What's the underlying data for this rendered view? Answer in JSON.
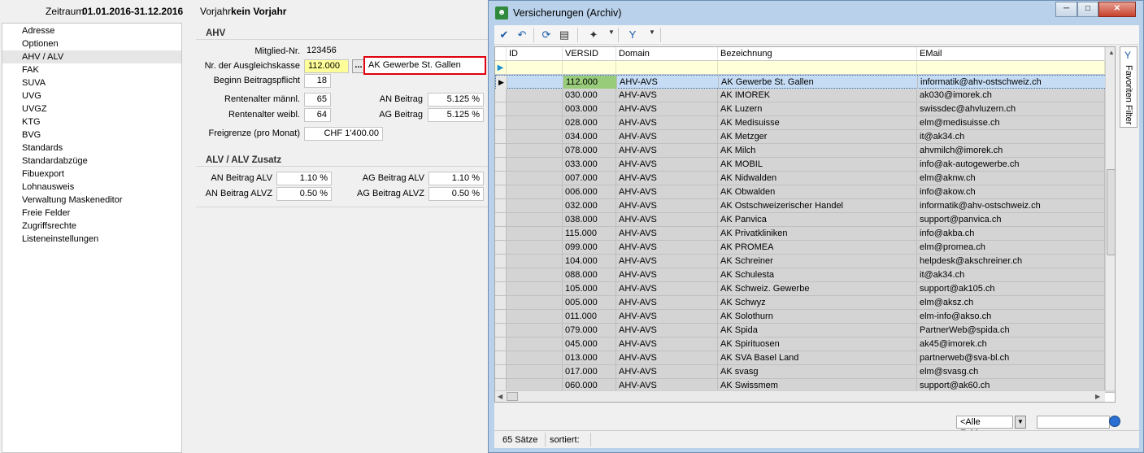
{
  "header": {
    "zeitraum_label": "Zeitraum",
    "zeitraum_value": "01.01.2016-31.12.2016",
    "vorjahr_label": "Vorjahr",
    "vorjahr_value": "kein Vorjahr"
  },
  "sidebar": {
    "items": [
      {
        "label": "Adresse"
      },
      {
        "label": "Optionen"
      },
      {
        "label": "AHV / ALV",
        "selected": true
      },
      {
        "label": "FAK"
      },
      {
        "label": "SUVA"
      },
      {
        "label": "UVG"
      },
      {
        "label": "UVGZ"
      },
      {
        "label": "KTG"
      },
      {
        "label": "BVG"
      },
      {
        "label": "Standards"
      },
      {
        "label": "Standardabzüge"
      },
      {
        "label": "Fibuexport"
      },
      {
        "label": "Lohnausweis"
      },
      {
        "label": "Verwaltung Maskeneditor"
      },
      {
        "label": "Freie Felder"
      },
      {
        "label": "Zugriffsrechte"
      },
      {
        "label": "Listeneinstellungen"
      }
    ]
  },
  "ahv": {
    "title": "AHV",
    "mitglied_label": "Mitglied-Nr.",
    "mitglied_value": "123456",
    "ausgleichskasse_label": "Nr. der Ausgleichskasse",
    "ausgleichskasse_value": "112.000",
    "ausgleichskasse_btn": "...",
    "ausgleichskasse_name": "AK Gewerbe St. Gallen",
    "beginn_label": "Beginn Beitragspflicht",
    "beginn_value": "18",
    "rente_m_label": "Rentenalter männl.",
    "rente_m_value": "65",
    "rente_w_label": "Rentenalter weibl.",
    "rente_w_value": "64",
    "an_label": "AN Beitrag",
    "an_value": "5.125 %",
    "ag_label": "AG Beitrag",
    "ag_value": "5.125 %",
    "freigrenze_label": "Freigrenze (pro Monat)",
    "freigrenze_value": "CHF 1'400.00"
  },
  "alv": {
    "title": "ALV / ALV Zusatz",
    "an_alv_label": "AN Beitrag ALV",
    "an_alv_value": "1.10 %",
    "ag_alv_label": "AG Beitrag ALV",
    "ag_alv_value": "1.10 %",
    "an_alvz_label": "AN Beitrag ALVZ",
    "an_alvz_value": "0.50 %",
    "ag_alvz_label": "AG Beitrag ALVZ",
    "ag_alvz_value": "0.50 %"
  },
  "dialog": {
    "title": "Versicherungen (Archiv)",
    "columns": [
      "ID",
      "VERSID",
      "Domain",
      "Bezeichnung",
      "EMail"
    ],
    "rows": [
      {
        "versid": "112.000",
        "domain": "AHV-AVS",
        "bez": "AK Gewerbe St. Gallen",
        "email": "informatik@ahv-ostschweiz.ch",
        "selected": true
      },
      {
        "versid": "030.000",
        "domain": "AHV-AVS",
        "bez": "AK IMOREK",
        "email": "ak030@imorek.ch"
      },
      {
        "versid": "003.000",
        "domain": "AHV-AVS",
        "bez": "AK Luzern",
        "email": "swissdec@ahvluzern.ch"
      },
      {
        "versid": "028.000",
        "domain": "AHV-AVS",
        "bez": "AK Medisuisse",
        "email": "elm@medisuisse.ch"
      },
      {
        "versid": "034.000",
        "domain": "AHV-AVS",
        "bez": "AK Metzger",
        "email": "it@ak34.ch"
      },
      {
        "versid": "078.000",
        "domain": "AHV-AVS",
        "bez": "AK Milch",
        "email": "ahvmilch@imorek.ch"
      },
      {
        "versid": "033.000",
        "domain": "AHV-AVS",
        "bez": "AK MOBIL",
        "email": "info@ak-autogewerbe.ch"
      },
      {
        "versid": "007.000",
        "domain": "AHV-AVS",
        "bez": "AK Nidwalden",
        "email": "elm@aknw.ch"
      },
      {
        "versid": "006.000",
        "domain": "AHV-AVS",
        "bez": "AK Obwalden",
        "email": "info@akow.ch"
      },
      {
        "versid": "032.000",
        "domain": "AHV-AVS",
        "bez": "AK Ostschweizerischer Handel",
        "email": "informatik@ahv-ostschweiz.ch"
      },
      {
        "versid": "038.000",
        "domain": "AHV-AVS",
        "bez": "AK Panvica",
        "email": "support@panvica.ch"
      },
      {
        "versid": "115.000",
        "domain": "AHV-AVS",
        "bez": "AK Privatkliniken",
        "email": "info@akba.ch"
      },
      {
        "versid": "099.000",
        "domain": "AHV-AVS",
        "bez": "AK PROMEA",
        "email": "elm@promea.ch"
      },
      {
        "versid": "104.000",
        "domain": "AHV-AVS",
        "bez": "AK Schreiner",
        "email": "helpdesk@akschreiner.ch"
      },
      {
        "versid": "088.000",
        "domain": "AHV-AVS",
        "bez": "AK Schulesta",
        "email": "it@ak34.ch"
      },
      {
        "versid": "105.000",
        "domain": "AHV-AVS",
        "bez": "AK Schweiz. Gewerbe",
        "email": "support@ak105.ch"
      },
      {
        "versid": "005.000",
        "domain": "AHV-AVS",
        "bez": "AK Schwyz",
        "email": "elm@aksz.ch"
      },
      {
        "versid": "011.000",
        "domain": "AHV-AVS",
        "bez": "AK Solothurn",
        "email": "elm-info@akso.ch"
      },
      {
        "versid": "079.000",
        "domain": "AHV-AVS",
        "bez": "AK Spida",
        "email": "PartnerWeb@spida.ch"
      },
      {
        "versid": "045.000",
        "domain": "AHV-AVS",
        "bez": "AK Spirituosen",
        "email": "ak45@imorek.ch"
      },
      {
        "versid": "013.000",
        "domain": "AHV-AVS",
        "bez": "AK SVA Basel Land",
        "email": "partnerweb@sva-bl.ch"
      },
      {
        "versid": "017.000",
        "domain": "AHV-AVS",
        "bez": "AK svasg",
        "email": "elm@svasg.ch"
      },
      {
        "versid": "060.000",
        "domain": "AHV-AVS",
        "bez": "AK Swissmem",
        "email": "support@ak60.ch"
      }
    ],
    "favorites_label": "Favoriten Filter",
    "search_scope": "<Alle Felder>",
    "status_count": "65 Sätze",
    "status_sort": "sortiert:"
  },
  "colors": {
    "highlight_border": "#e0000f",
    "field_yellow": "#ffff99",
    "versid_green": "#99cc7a",
    "selected_row": "#c5dcf4"
  }
}
